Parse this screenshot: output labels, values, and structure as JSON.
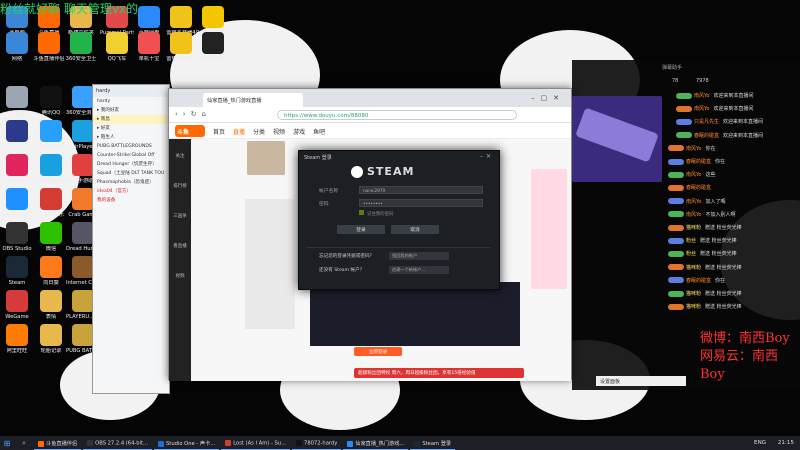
{
  "overlay": {
    "title": "粉丝就好聊 聊天管理vx的",
    "weibo_line1": "微博：南西Boy",
    "weibo_line2": "网易云：南西Boy"
  },
  "desktop_icons": [
    {
      "label": "此电脑",
      "color": "#3b86d6"
    },
    {
      "label": "斗鱼直播",
      "color": "#ff6a00"
    },
    {
      "label": "新建文件夹",
      "color": "#e8b94a"
    },
    {
      "label": "Pummel Party",
      "color": "#e04a4a"
    },
    {
      "label": "百度网盘",
      "color": "#2b8af7"
    },
    {
      "label": "雷电多开器4",
      "color": "#f0c21a"
    },
    {
      "label": "PotPlayer 64 bit",
      "color": "#f3c600"
    },
    {
      "label": "网络",
      "color": "#3b86d6"
    },
    {
      "label": "斗鱼直播伴侣",
      "color": "#ff6a00"
    },
    {
      "label": "360安全卫士",
      "color": "#24b34b"
    },
    {
      "label": "QQ飞车",
      "color": "#f0d030"
    },
    {
      "label": "单机十宝",
      "color": "#f05050"
    },
    {
      "label": "雷电模拟器4",
      "color": "#f0c21a"
    },
    {
      "label": "剪映专业版",
      "color": "#222"
    },
    {
      "label": "回收站",
      "color": "#9aa7b3"
    },
    {
      "label": "腾讯QQ",
      "color": "#111"
    },
    {
      "label": "360安全浏览器",
      "color": "#3aa0ff"
    },
    {
      "label": "SE",
      "color": "#2b3a8a"
    },
    {
      "label": "腾讯视频",
      "color": "#27a0ff"
    },
    {
      "label": "AirPlayer",
      "color": "#1ba1e2"
    },
    {
      "label": "GeeGee",
      "color": "#e0245e"
    },
    {
      "label": "网易UU加速器",
      "color": "#18a0e0"
    },
    {
      "label": "腾讯手游助手",
      "color": "#e04040"
    },
    {
      "label": "Logitech G HUB",
      "color": "#1e90ff"
    },
    {
      "label": "网易云音乐",
      "color": "#d43c33"
    },
    {
      "label": "Crab Game",
      "color": "#f07a2a"
    },
    {
      "label": "OBS Studio",
      "color": "#333"
    },
    {
      "label": "微信",
      "color": "#2dc100"
    },
    {
      "label": "Dread Hunger",
      "color": "#556"
    },
    {
      "label": "Steam",
      "color": "#1b2838"
    },
    {
      "label": "向日葵",
      "color": "#ff7a1a"
    },
    {
      "label": "Internet Cafe Si...",
      "color": "#8a5a2a"
    },
    {
      "label": "WeGame",
      "color": "#d63a3a"
    },
    {
      "label": "表情",
      "color": "#e8b94a"
    },
    {
      "label": "PLAYERU... BATTLEGR...",
      "color": "#c8a23a"
    },
    {
      "label": "阿里旺旺",
      "color": "#ff7a00"
    },
    {
      "label": "轮胎记录",
      "color": "#e8b94a"
    },
    {
      "label": "PUBG BATTLEGR...",
      "color": "#c8a23a"
    }
  ],
  "qq_window": {
    "header": "hardy",
    "rows": [
      "hardy",
      "▸ 我的好友",
      "▸ 南昌",
      "▸ 好友",
      "▸ 陌生人",
      "PUBG BATTLEGROUNDS",
      "Counter-Strike:Global Off",
      "Dread Hunger（饥荒生存）",
      "Squad（土豆陆 DLT TANK TOU",
      "Phasmophobia（恐鬼症）",
      "idea04（官方）",
      "我的设备"
    ]
  },
  "browser": {
    "tab_title": "仙家直播_热门游戏直播",
    "url": "https://www.douyu.com/88080",
    "logo": "斗鱼",
    "nav": [
      "首页",
      "直播",
      "分类",
      "视频",
      "游戏",
      "鱼吧"
    ],
    "active_nav": "直播",
    "side_nav": [
      "关注",
      "排行榜",
      "三国杀",
      "看直播",
      "视频"
    ],
    "gift_bar": "超级粉丝团特权  周六，周日超级粉丝团，享有15倍经验值",
    "live_button": "立即登录"
  },
  "steam": {
    "window_title": "Steam 登录",
    "brand": "STEAM",
    "account_label": "帐户名称",
    "account_value": "nanxi2979",
    "password_label": "密码",
    "password_value": "••••••••",
    "remember": "记住我的密码",
    "login_btn": "登录",
    "cancel_btn": "取消",
    "forgot": "忘记您的登录凭据或密码？",
    "forgot_action": "找回我的帐户",
    "no_account": "还没有 Steam 帐户？",
    "create_action": "创建一个新帐户..."
  },
  "chat": {
    "header": "弹幕助手",
    "stats": [
      "78",
      "7978"
    ],
    "lines": [
      {
        "name": "南风Yo",
        "msg": "欢迎来到本直播间",
        "color": "#ff8a2b"
      },
      {
        "name": "南风Yo",
        "msg": "欢迎来到本直播间",
        "color": "#ff8a2b"
      },
      {
        "name": "只是凡先生",
        "msg": "欢迎来到本直播间",
        "color": "#ff8a2b"
      },
      {
        "name": "春眠的碰盒",
        "msg": "欢迎来到本直播间",
        "color": "#ff8a2b"
      },
      {
        "name": "南风Yo",
        "msg": "你在",
        "color": "#ff8a2b"
      },
      {
        "name": "春眠的碰盒",
        "msg": "你在",
        "color": "#ff8a2b"
      },
      {
        "name": "南风Yo",
        "msg": "这些",
        "color": "#ff8a2b"
      },
      {
        "name": "春眠的碰盒",
        "msg": "",
        "color": "#ff8a2b"
      },
      {
        "name": "南风Yo",
        "msg": "加入了嗎",
        "color": "#ff8a2b"
      },
      {
        "name": "南风Yo",
        "msg": "不加入别人啊",
        "color": "#ff8a2b"
      },
      {
        "name": "猫咪粉",
        "msg": "赠送 粉丝荧光棒",
        "color": "#ffe066"
      },
      {
        "name": "粉丝",
        "msg": "赠送 粉丝荧光棒",
        "color": "#ffe066"
      },
      {
        "name": "粉丝",
        "msg": "赠送 粉丝荧光棒",
        "color": "#ffe066"
      },
      {
        "name": "猫咪粉",
        "msg": "赠送 粉丝荧光棒",
        "color": "#ffe066"
      },
      {
        "name": "春眠的碰盒",
        "msg": "你在",
        "color": "#ff8a2b"
      },
      {
        "name": "猫咪粉",
        "msg": "赠送 粉丝荧光棒",
        "color": "#ffe066"
      },
      {
        "name": "猫咪粉",
        "msg": "赠送 粉丝荧光棒",
        "color": "#ffe066"
      }
    ],
    "bottom_label": "设置面板"
  },
  "taskbar": {
    "items": [
      {
        "label": "斗鱼直播伴侣",
        "color": "#ff6a00"
      },
      {
        "label": "OBS 27.2.4 (64-bit...",
        "color": "#333"
      },
      {
        "label": "Studio One - 声卡...",
        "color": "#1a6fd1"
      },
      {
        "label": "Lost (As I Am) - Su...",
        "color": "#d43c33"
      },
      {
        "label": "78072-hardy",
        "color": "#111"
      },
      {
        "label": "仙家直播_热门游戏...",
        "color": "#2b8af7"
      },
      {
        "label": "Steam 登录",
        "color": "#1b2838"
      }
    ],
    "tray": "ENG",
    "clock": "21:15"
  }
}
